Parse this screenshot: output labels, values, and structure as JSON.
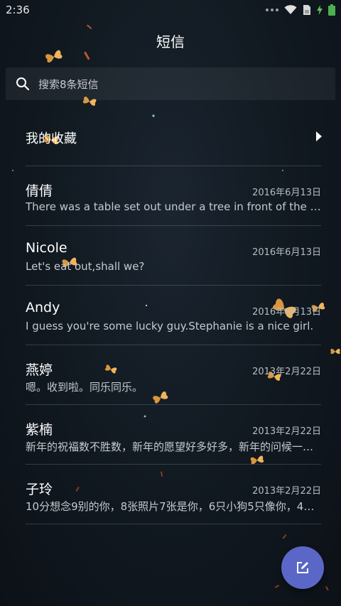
{
  "status_bar": {
    "time": "2:36",
    "icons": [
      "signal-dots-icon",
      "wifi-icon",
      "sim-icon",
      "charging-icon",
      "battery-icon"
    ]
  },
  "header": {
    "title": "短信"
  },
  "search": {
    "placeholder": "搜索8条短信",
    "icon": "search-icon"
  },
  "favorites": {
    "label": "我的收藏",
    "icon": "chevron-right-icon"
  },
  "conversations": [
    {
      "name": "倩倩",
      "date": "2016年6月13日",
      "preview": "There was a table set out under a tree in front of the house, and the March Hare and the Hatter were having tea at it"
    },
    {
      "name": "Nicole",
      "date": "2016年6月13日",
      "preview": "Let's eat out,shall we?"
    },
    {
      "name": "Andy",
      "date": "2016年6月13日",
      "preview": "I guess you're some lucky guy.Stephanie is a nice girl."
    },
    {
      "name": "燕婷",
      "date": "2013年2月22日",
      "preview": "嗯。收到啦。同乐同乐。"
    },
    {
      "name": "紫楠",
      "date": "2013年2月22日",
      "preview": "新年的祝福数不胜数，新年的愿望好多好多，新年的问候一句就够"
    },
    {
      "name": "子玲",
      "date": "2013年2月22日",
      "preview": "10分想念9别的你，8张照片7张是你，6只小狗5只像你，4…"
    }
  ],
  "fab": {
    "icon": "compose-icon"
  },
  "colors": {
    "background": "#121a22",
    "fab": "#5a67c6",
    "text_primary": "#ffffff",
    "text_secondary": "#b7bcc2",
    "battery": "#4caf50"
  }
}
